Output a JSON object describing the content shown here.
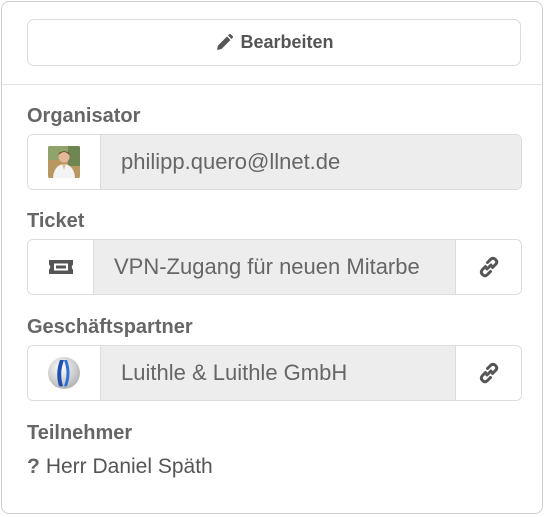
{
  "edit_button": {
    "label": "Bearbeiten",
    "icon": "pencil-icon"
  },
  "organizer": {
    "label": "Organisator",
    "email": "philipp.quero@llnet.de",
    "icon": "avatar"
  },
  "ticket": {
    "label": "Ticket",
    "value": "VPN-Zugang für neuen Mitarbe",
    "icon": "ticket-icon",
    "action_icon": "link-icon"
  },
  "partner": {
    "label": "Geschäftspartner",
    "value": "Luithle & Luithle GmbH",
    "icon": "company-logo",
    "action_icon": "link-icon"
  },
  "participants": {
    "label": "Teilnehmer",
    "items": [
      {
        "status_icon": "?",
        "name": "Herr Daniel Späth"
      }
    ]
  },
  "colors": {
    "label_text": "#666666",
    "field_bg": "#ededed",
    "border": "#dcdcdc"
  }
}
